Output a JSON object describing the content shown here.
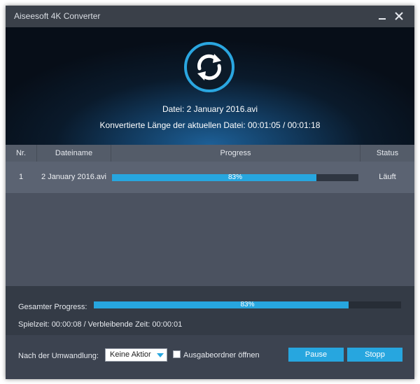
{
  "window": {
    "title": "Aiseesoft 4K Converter"
  },
  "hero": {
    "file_line": "Datei: 2 January 2016.avi",
    "length_line": "Konvertierte Länge der aktuellen Datei: 00:01:05 / 00:01:18",
    "icon": "refresh-icon"
  },
  "table": {
    "columns": [
      "Nr.",
      "Dateiname",
      "Progress",
      "Status"
    ],
    "rows": [
      {
        "nr": "1",
        "filename": "2 January 2016.avi",
        "progress": 0.83,
        "progress_label": "83%",
        "status": "Läuft"
      }
    ]
  },
  "total": {
    "label": "Gesamter Progress:",
    "progress": 0.83,
    "progress_label": "83%",
    "time_line": "Spielzeit: 00:00:08 / Verbleibende Zeit: 00:00:01"
  },
  "footer": {
    "after_label": "Nach der Umwandlung:",
    "after_action": "Keine Aktior",
    "open_folder_label": "Ausgabeordner öffnen",
    "open_folder_checked": false,
    "pause_label": "Pause",
    "stop_label": "Stopp"
  },
  "colors": {
    "accent": "#27a6df",
    "window_bg": "#3c4350",
    "row_bg": "#5b6372"
  }
}
